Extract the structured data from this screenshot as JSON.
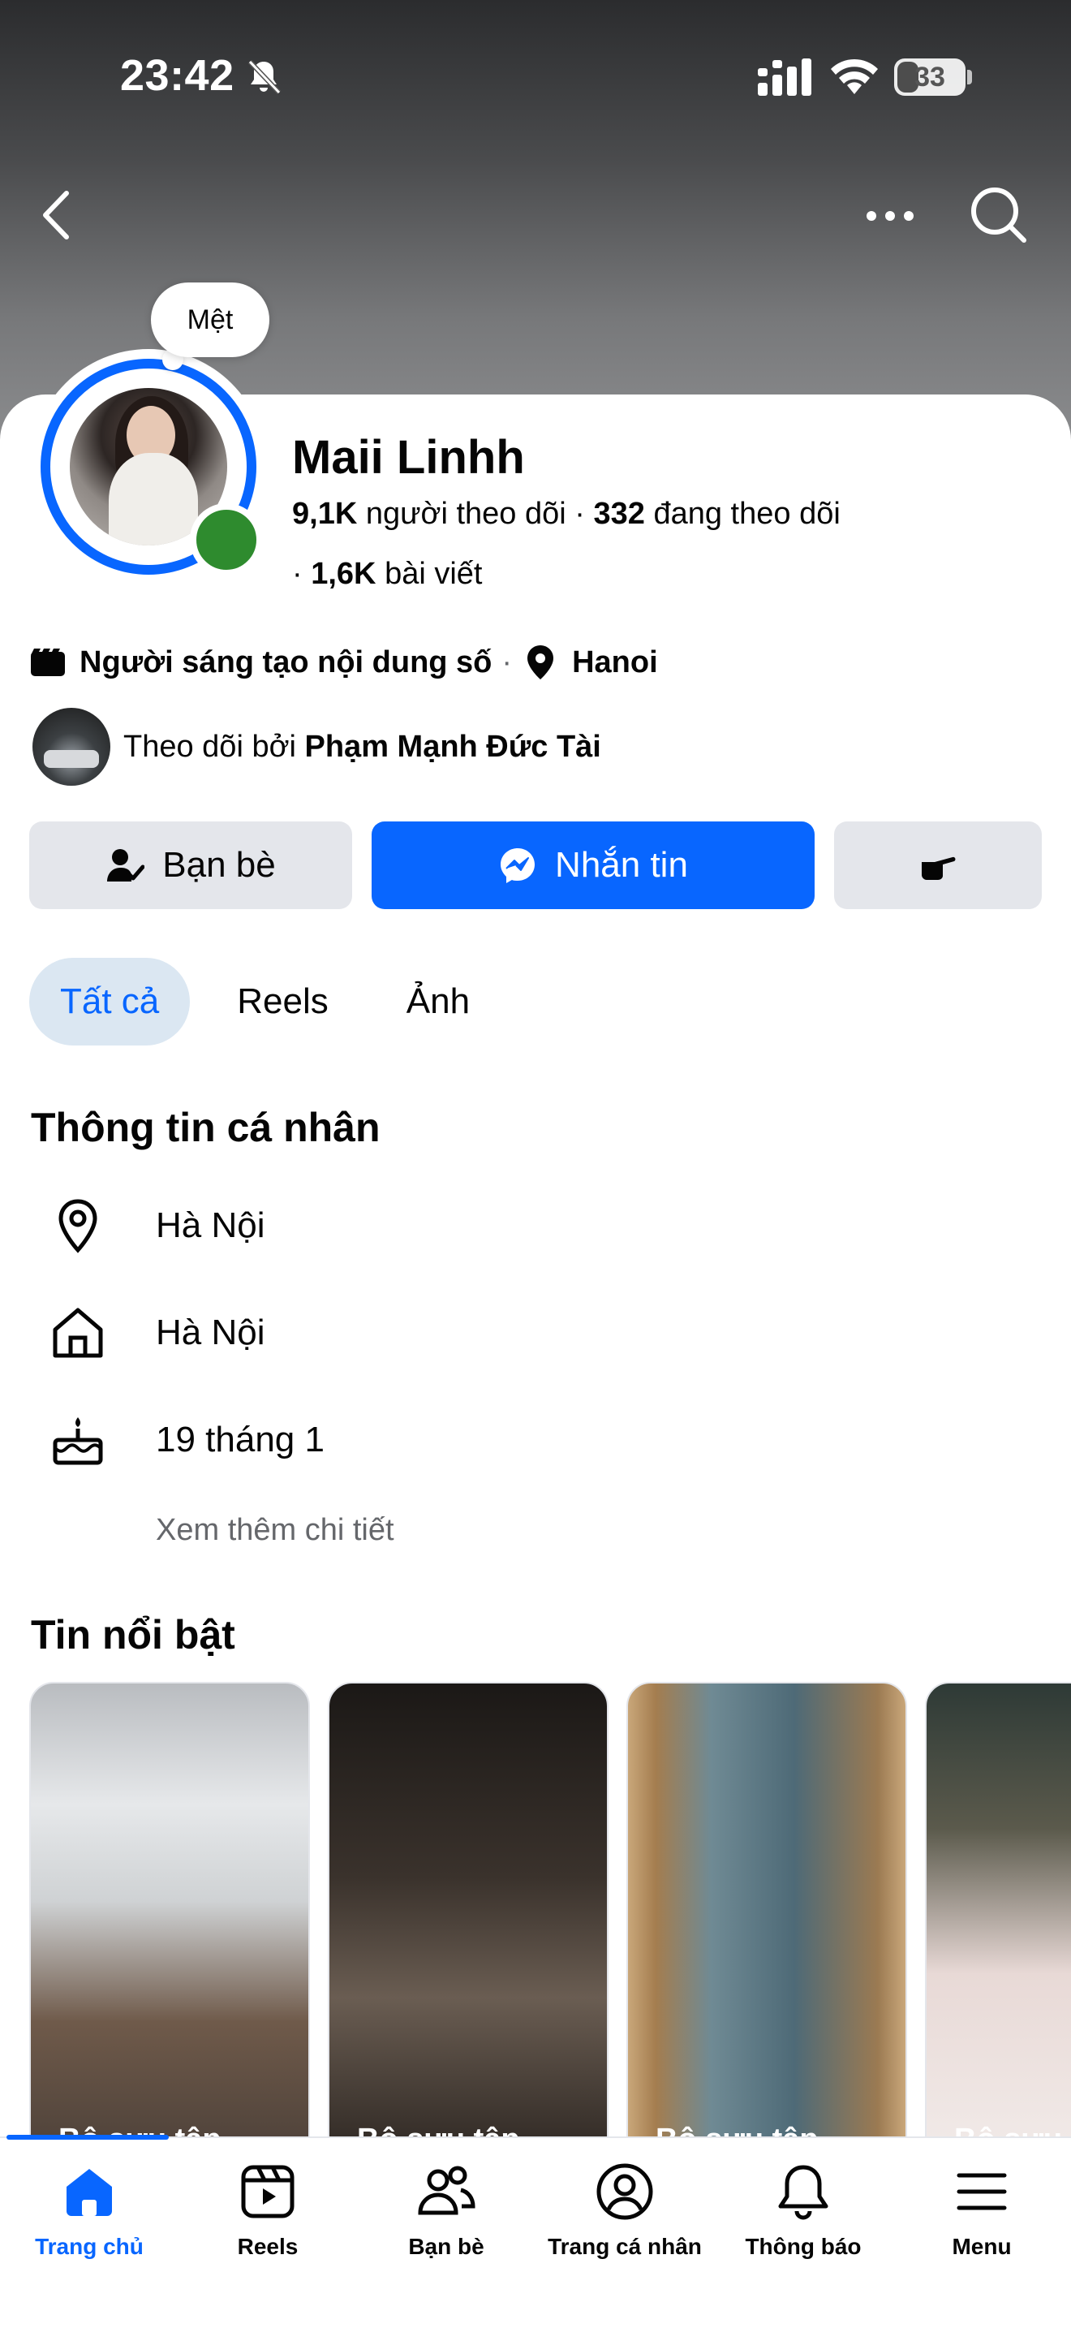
{
  "status_bar": {
    "time": "23:42",
    "battery": "33"
  },
  "header": {
    "note": "Mệt"
  },
  "profile": {
    "name": "Maii Linhh",
    "followers_count": "9,1K",
    "followers_label": "người theo dõi",
    "following_count": "332",
    "following_label": "đang theo dõi",
    "posts_count": "1,6K",
    "posts_label": "bài viết",
    "category": "Người sáng tạo nội dung số",
    "location": "Hanoi",
    "followed_by_prefix": "Theo dõi bởi",
    "followed_by_name": "Phạm Mạnh Đức Tài"
  },
  "actions": {
    "friends_label": "Bạn bè",
    "message_label": "Nhắn tin"
  },
  "tabs": [
    {
      "label": "Tất cả",
      "active": true
    },
    {
      "label": "Reels",
      "active": false
    },
    {
      "label": "Ảnh",
      "active": false
    }
  ],
  "personal_info": {
    "title": "Thông tin cá nhân",
    "items": [
      {
        "icon": "location-pin-icon",
        "text": "Hà Nội"
      },
      {
        "icon": "home-icon",
        "text": "Hà Nội"
      },
      {
        "icon": "birthday-cake-icon",
        "text": "19 tháng 1"
      }
    ],
    "see_more": "Xem thêm chi tiết"
  },
  "highlights": {
    "title": "Tin nổi bật",
    "items": [
      {
        "label": "Bộ sưu tập"
      },
      {
        "label": "Bộ sưu tập"
      },
      {
        "label": "Bộ sưu tập"
      },
      {
        "label": "Bộ sưu tập"
      }
    ]
  },
  "bottom_nav": [
    {
      "label": "Trang chủ",
      "icon": "home-icon",
      "active": true
    },
    {
      "label": "Reels",
      "icon": "reels-icon",
      "active": false
    },
    {
      "label": "Bạn bè",
      "icon": "friends-icon",
      "active": false
    },
    {
      "label": "Trang cá nhân",
      "icon": "profile-icon",
      "active": false
    },
    {
      "label": "Thông báo",
      "icon": "bell-icon",
      "active": false
    },
    {
      "label": "Menu",
      "icon": "menu-icon",
      "active": false
    }
  ],
  "colors": {
    "accent": "#0866ff",
    "online": "#2e8b2e",
    "button_gray": "#e4e6eb",
    "tab_active_bg": "#dbe7f2"
  }
}
